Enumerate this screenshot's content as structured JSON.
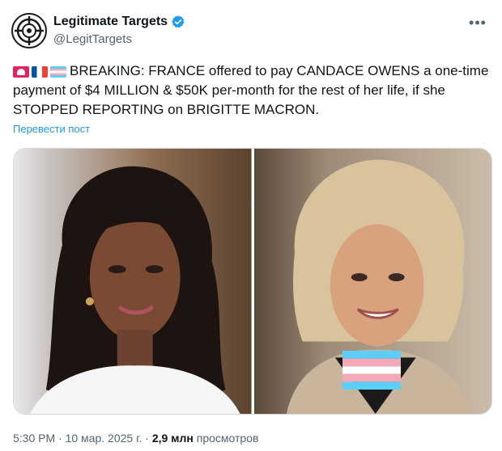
{
  "author": {
    "display_name": "Legitimate Targets",
    "handle": "@LegitTargets",
    "verified": true,
    "avatar_icon": "crosshair-target-icon",
    "more_icon": "more-options-icon"
  },
  "tweet": {
    "text": "BREAKING: FRANCE offered to pay CANDACE OWENS a one-time payment of $4 MILLION & $50K per-month for the rest of her life, if she STOPPED REPORTING on BRIGITTE MACRON.",
    "emoji_icons": [
      "rotating-light-icon",
      "france-flag-icon",
      "transgender-flag-icon"
    ],
    "translate_label": "Перевести пост"
  },
  "media": {
    "photos": [
      {
        "description_icon": "photo-woman-left"
      },
      {
        "description_icon": "photo-woman-right",
        "overlay_icon": "transgender-flag-icon"
      }
    ]
  },
  "footer": {
    "time": "5:30 PM",
    "separator": "·",
    "date": "10 мар. 2025 г.",
    "views_count": "2,9 млн",
    "views_label": "просмотров"
  },
  "colors": {
    "accent": "#1d9bf0",
    "secondary_text": "#536471"
  }
}
